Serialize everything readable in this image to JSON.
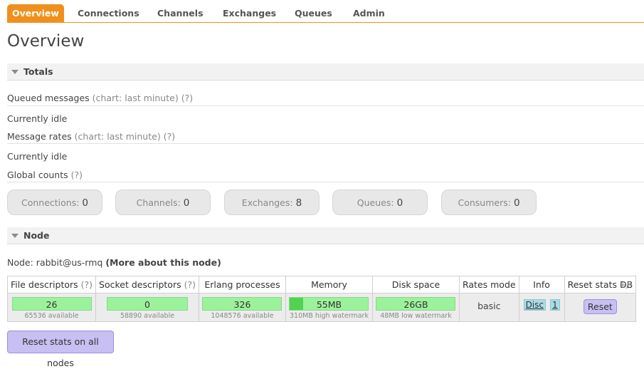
{
  "nav": {
    "tabs": [
      "Overview",
      "Connections",
      "Channels",
      "Exchanges",
      "Queues",
      "Admin"
    ]
  },
  "page_title": "Overview",
  "totals": {
    "header": "Totals",
    "queued_messages": "Queued messages",
    "queued_chart": "(chart: last minute)",
    "queued_status": "Currently idle",
    "message_rates": "Message rates",
    "rates_chart": "(chart: last minute)",
    "rates_status": "Currently idle",
    "global_counts": "Global counts",
    "help": "(?)",
    "counts": [
      {
        "label": "Connections:",
        "value": "0"
      },
      {
        "label": "Channels:",
        "value": "0"
      },
      {
        "label": "Exchanges:",
        "value": "8"
      },
      {
        "label": "Queues:",
        "value": "0"
      },
      {
        "label": "Consumers:",
        "value": "0"
      }
    ]
  },
  "node": {
    "header": "Node",
    "prefix": "Node: rabbit@us-rmq",
    "more_link": "(More about this node)",
    "columns": [
      "File descriptors",
      "Socket descriptors",
      "Erlang processes",
      "Memory",
      "Disk space",
      "Rates mode",
      "Info",
      "Reset stats DB"
    ],
    "help": "(?)",
    "file_descriptors": {
      "value": "26",
      "sub": "65536 available"
    },
    "socket_descriptors": {
      "value": "0",
      "sub": "58890 available"
    },
    "erlang_processes": {
      "value": "326",
      "sub": "1048576 available"
    },
    "memory": {
      "value": "55MB",
      "sub": "310MB high watermark",
      "fill_fraction": 0.17
    },
    "disk_space": {
      "value": "26GB",
      "sub": "48MB low watermark"
    },
    "rates_mode": "basic",
    "info_disc": "Disc",
    "info_count": "1",
    "reset_button": "Reset",
    "plus_minus": "+/-"
  },
  "reset_all_button": "Reset stats on all nodes",
  "colors": {
    "accent": "#f0901c",
    "bar_green": "#9cf29c",
    "button_purple": "#c8bff2",
    "info_blue": "#a9dce4"
  }
}
